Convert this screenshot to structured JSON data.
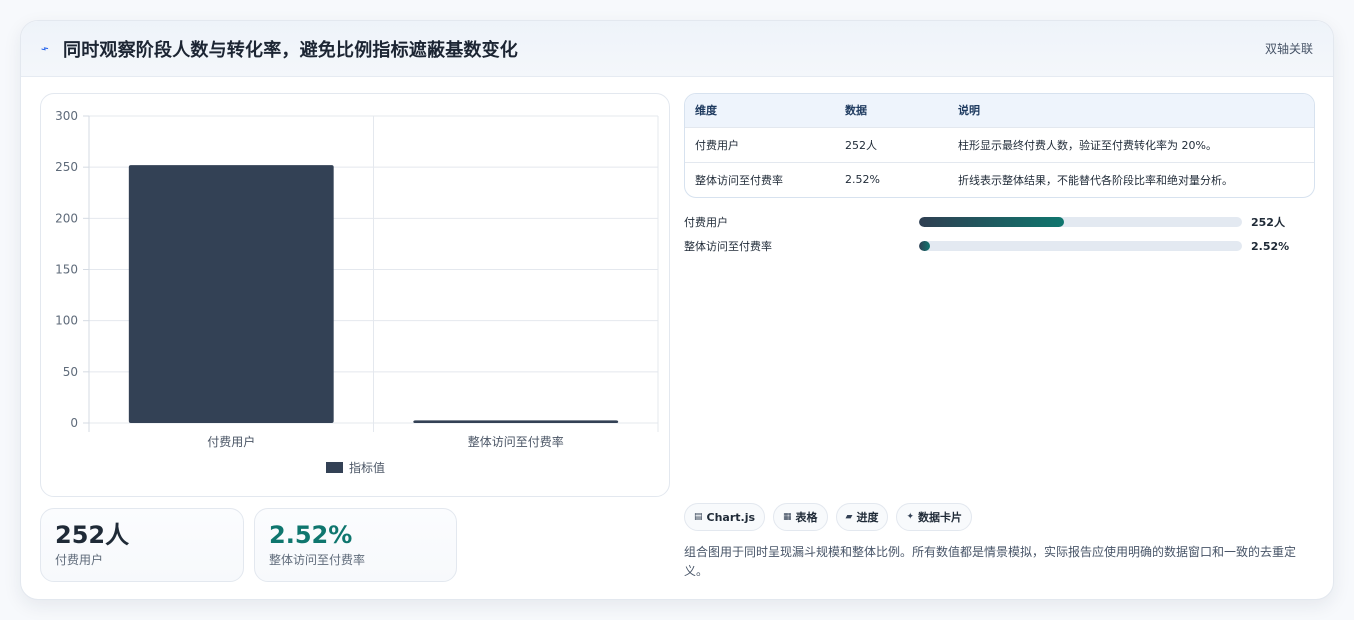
{
  "header": {
    "icon": "trend-icon",
    "title": "同时观察阶段人数与转化率，避免比例指标遮蔽基数变化",
    "tag": "双轴关联"
  },
  "chart_data": {
    "type": "bar",
    "categories": [
      "付费用户",
      "整体访问至付费率"
    ],
    "series": [
      {
        "name": "指标值",
        "values": [
          252,
          2.52
        ],
        "color": "#334155"
      }
    ],
    "ylim": [
      0,
      300
    ],
    "yticks": [
      0,
      50,
      100,
      150,
      200,
      250,
      300
    ],
    "grid": true,
    "legend": "bottom"
  },
  "kpis": [
    {
      "value": "252人",
      "label": "付费用户"
    },
    {
      "value": "2.52%",
      "label": "整体访问至付费率"
    }
  ],
  "table": {
    "headers": [
      "维度",
      "数据",
      "说明"
    ],
    "rows": [
      [
        "付费用户",
        "252人",
        "柱形显示最终付费人数，验证至付费转化率为 20%。"
      ],
      [
        "整体访问至付费率",
        "2.52%",
        "折线表示整体结果，不能替代各阶段比率和绝对量分析。"
      ]
    ]
  },
  "progress": [
    {
      "label": "付费用户",
      "value": "252人",
      "fraction": 0.45
    },
    {
      "label": "整体访问至付费率",
      "value": "2.52%",
      "fraction": 0.0252
    }
  ],
  "chips": [
    {
      "icon": "chart-icon",
      "glyph": "▤",
      "label": "Chart.js"
    },
    {
      "icon": "table-icon",
      "glyph": "▦",
      "label": "表格"
    },
    {
      "icon": "progress-icon",
      "glyph": "▰",
      "label": "进度"
    },
    {
      "icon": "card-icon",
      "glyph": "✦",
      "label": "数据卡片"
    }
  ],
  "note": "组合图用于同时呈现漏斗规模和整体比例。所有数值都是情景模拟，实际报告应使用明确的数据窗口和一致的去重定义。"
}
